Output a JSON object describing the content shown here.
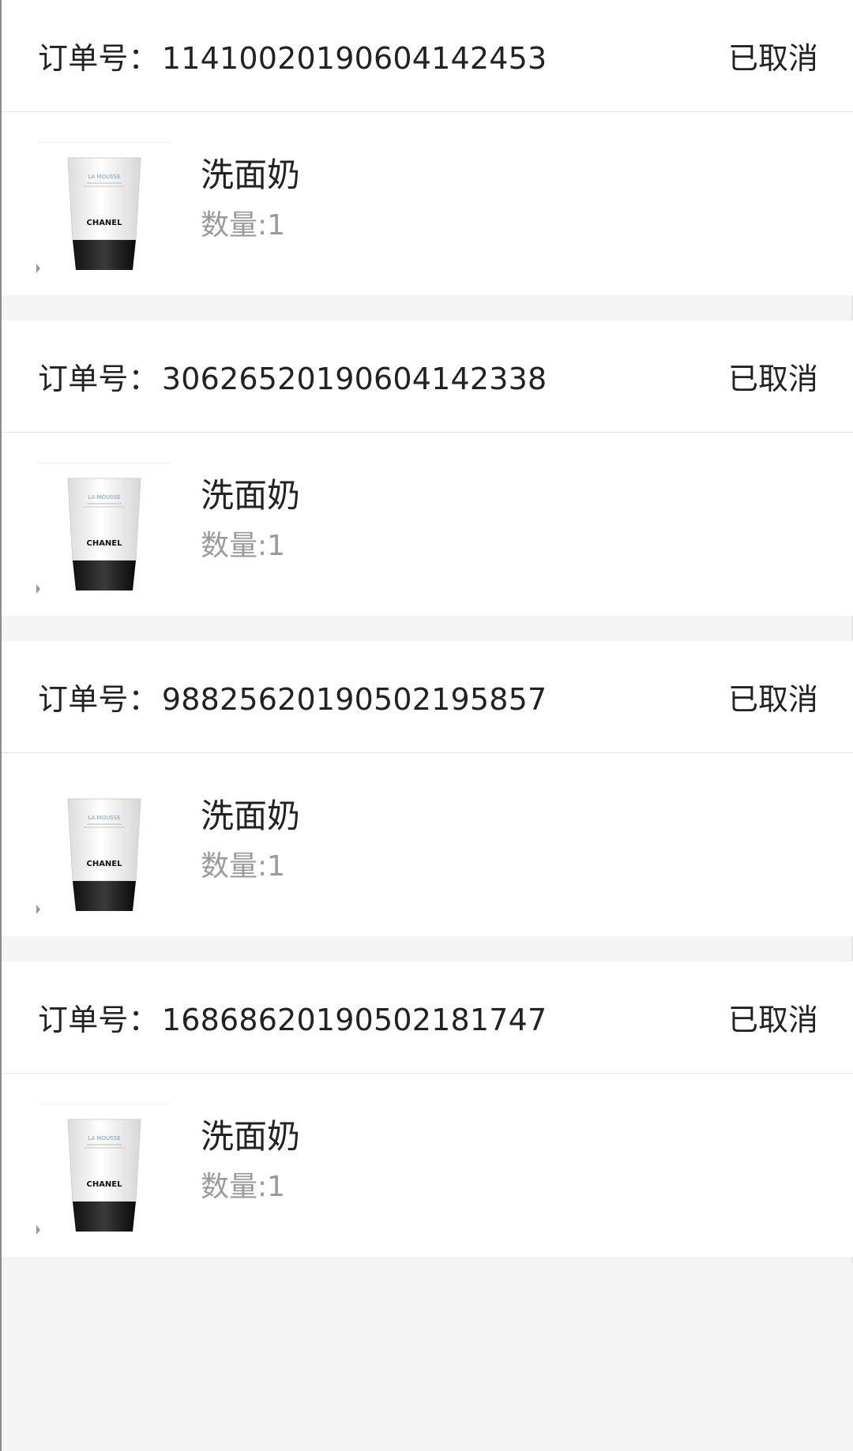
{
  "orders": [
    {
      "order_label": "订单号：",
      "order_number": "11410020190604142453",
      "status": "已取消",
      "product_name": "洗面奶",
      "quantity": "数量:1",
      "brand_text": "CHANEL",
      "product_line": "LA MOUSSE"
    },
    {
      "order_label": "订单号：",
      "order_number": "30626520190604142338",
      "status": "已取消",
      "product_name": "洗面奶",
      "quantity": "数量:1",
      "brand_text": "CHANEL",
      "product_line": "LA MOUSSE"
    },
    {
      "order_label": "订单号：",
      "order_number": "98825620190502195857",
      "status": "已取消",
      "product_name": "洗面奶",
      "quantity": "数量:1",
      "brand_text": "CHANEL",
      "product_line": "LA MOUSSE"
    },
    {
      "order_label": "订单号：",
      "order_number": "16868620190502181747",
      "status": "已取消",
      "product_name": "洗面奶",
      "quantity": "数量:1",
      "brand_text": "CHANEL",
      "product_line": "LA MOUSSE"
    }
  ],
  "colors": {
    "background": "#f4f4f4",
    "card": "#ffffff",
    "text": "#222222",
    "muted_text": "#9a9a9a",
    "tube_cap": "#111111"
  }
}
